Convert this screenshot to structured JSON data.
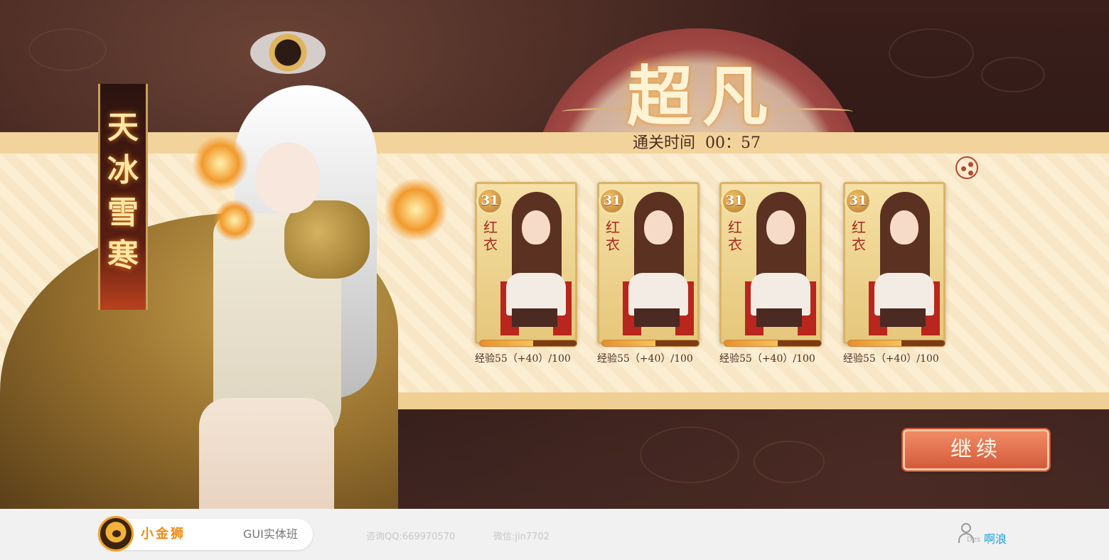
{
  "title": "超凡",
  "clear_time": {
    "label": "通关时间",
    "value": "00：57"
  },
  "hero": {
    "name": "天冰雪寒"
  },
  "cards": [
    {
      "level": "31",
      "name": "红衣",
      "exp": "经验55（+40）/100",
      "exp_progress": 0.55
    },
    {
      "level": "31",
      "name": "红衣",
      "exp": "经验55（+40）/100",
      "exp_progress": 0.55
    },
    {
      "level": "31",
      "name": "红衣",
      "exp": "经验55（+40）/100",
      "exp_progress": 0.55
    },
    {
      "level": "31",
      "name": "红衣",
      "exp": "经验55（+40）/100",
      "exp_progress": 0.55
    }
  ],
  "continue_label": "继续",
  "share_icon": "share-icon",
  "footer": {
    "brand_name": "小金狮",
    "course": "GUI实体班",
    "qq": "咨询QQ:669970570",
    "wechat": "微信:jin7702",
    "user_des": "Des",
    "user_name": "啊浪"
  },
  "colors": {
    "accent": "#d45b3b",
    "band": "#fbeed3",
    "gold": "#e0b45c"
  }
}
